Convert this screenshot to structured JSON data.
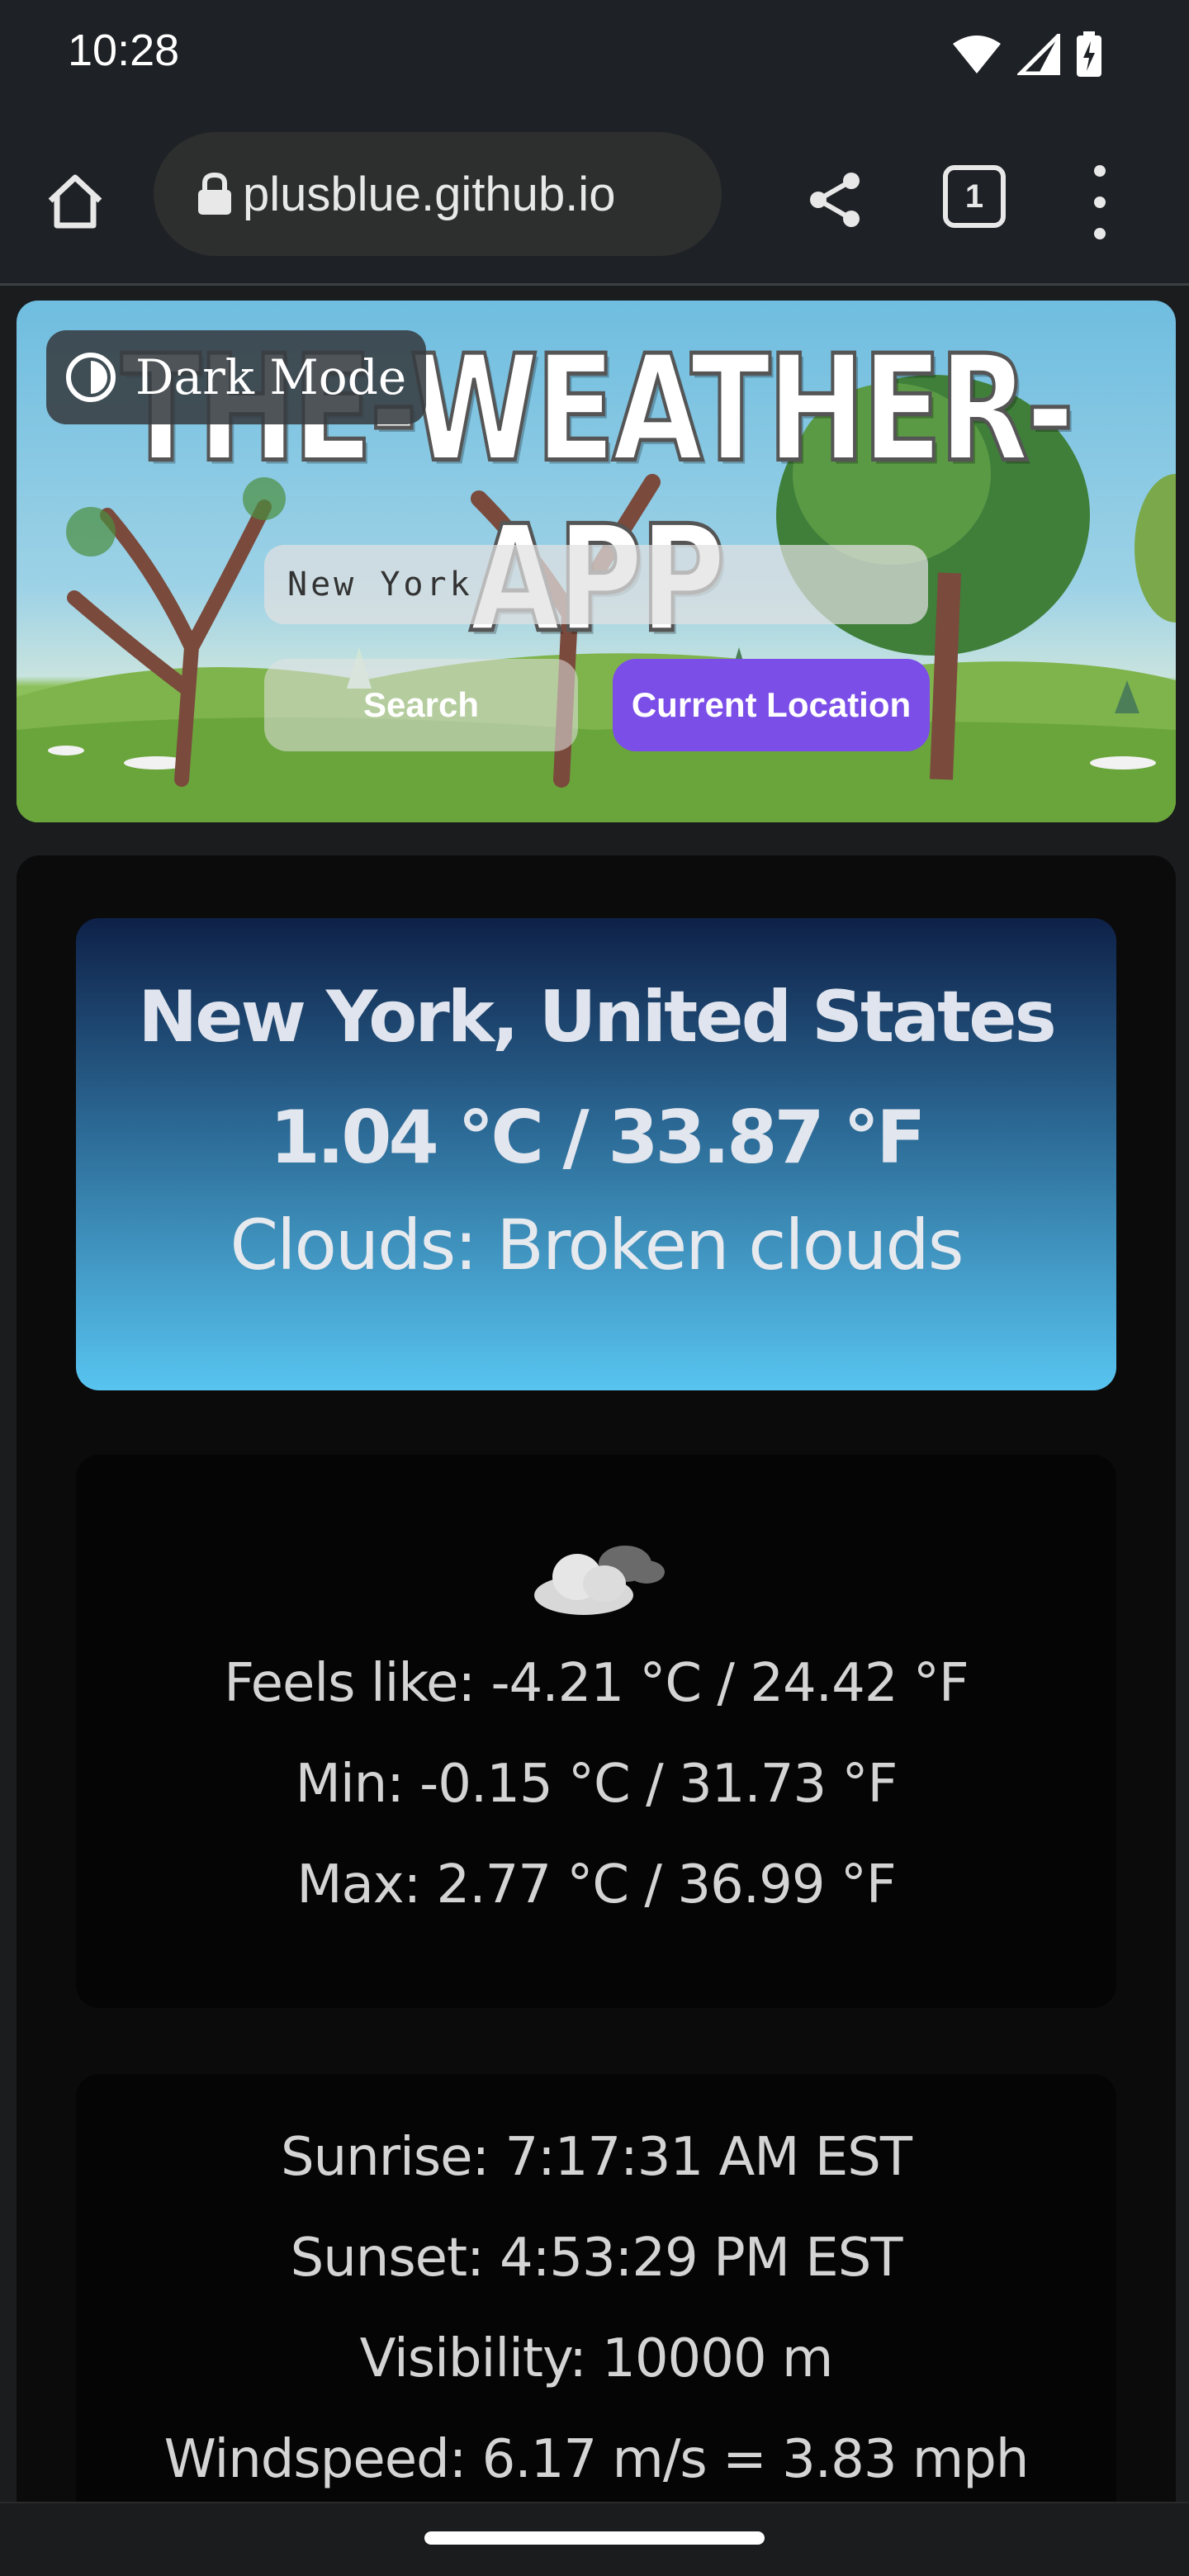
{
  "status_bar": {
    "time": "10:28"
  },
  "browser": {
    "url": "plusblue.github.io",
    "tab_count": "1"
  },
  "hero": {
    "title": "THE-WEATHER-APP",
    "dark_mode_label": "Dark Mode",
    "search_value": "New York",
    "search_button": "Search",
    "location_button": "Current Location"
  },
  "summary": {
    "city": "New York, United States",
    "temperature": "1.04 °C / 33.87 °F",
    "description": "Clouds: Broken clouds"
  },
  "details": {
    "icon": "broken-clouds-icon",
    "feels_like": "Feels like: -4.21 °C / 24.42 °F",
    "min": "Min: -0.15 °C / 31.73 °F",
    "max": "Max: 2.77 °C / 36.99 °F"
  },
  "sun": {
    "sunrise": "Sunrise: 7:17:31 AM EST",
    "sunset": "Sunset: 4:53:29 PM EST",
    "visibility": "Visibility: 10000 m",
    "windspeed": "Windspeed: 6.17 m/s = 3.83 mph"
  },
  "colors": {
    "accent": "#7b4ee8",
    "card_gradient_top": "#0e2148",
    "card_gradient_bottom": "#58c4f0",
    "panel": "#0b0b0c"
  }
}
